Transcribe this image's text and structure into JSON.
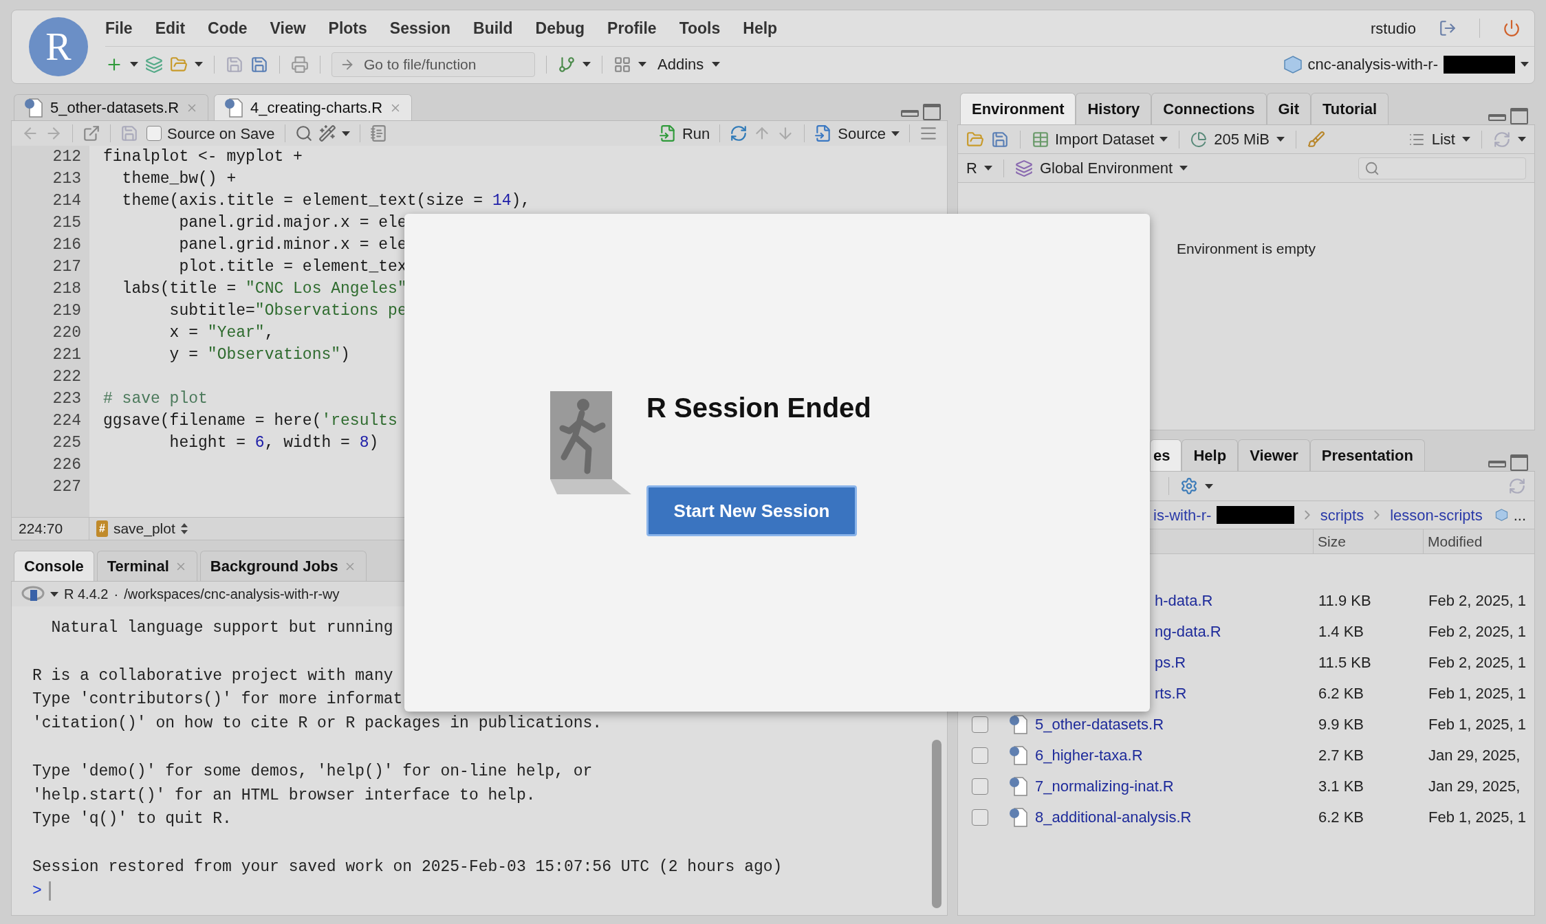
{
  "menu_bar": {
    "logo": "R",
    "items": [
      "File",
      "Edit",
      "Code",
      "View",
      "Plots",
      "Session",
      "Build",
      "Debug",
      "Profile",
      "Tools",
      "Help"
    ],
    "user": "rstudio"
  },
  "main_toolbar": {
    "goto_placeholder": "Go to file/function",
    "addins": "Addins",
    "project": "cnc-analysis-with-r-"
  },
  "editor": {
    "tabs": [
      {
        "label": "5_other-datasets.R",
        "selected": false
      },
      {
        "label": "4_creating-charts.R",
        "selected": true
      }
    ],
    "toolbar": {
      "source_on_save": {
        "label": "Source on Save",
        "checked": false
      },
      "run": "Run",
      "source": "Source"
    },
    "lines": [
      {
        "number": "212",
        "tokens": [
          {
            "kind": "code",
            "text": "finalplot <- myplot +"
          }
        ]
      },
      {
        "number": "213",
        "tokens": [
          {
            "kind": "code",
            "text": "  theme_bw() +"
          }
        ]
      },
      {
        "number": "214",
        "tokens": [
          {
            "kind": "code",
            "text": "  theme(axis.title = element_text(size = "
          },
          {
            "kind": "num",
            "text": "14"
          },
          {
            "kind": "code",
            "text": "),"
          }
        ]
      },
      {
        "number": "215",
        "tokens": [
          {
            "kind": "code",
            "text": "        panel.grid.major.x = ele"
          }
        ]
      },
      {
        "number": "216",
        "tokens": [
          {
            "kind": "code",
            "text": "        panel.grid.minor.x = ele"
          }
        ]
      },
      {
        "number": "217",
        "tokens": [
          {
            "kind": "code",
            "text": "        plot.title = element_tex"
          }
        ]
      },
      {
        "number": "218",
        "tokens": [
          {
            "kind": "code",
            "text": "  labs(title = "
          },
          {
            "kind": "str",
            "text": "\"CNC Los Angeles\""
          }
        ]
      },
      {
        "number": "219",
        "tokens": [
          {
            "kind": "code",
            "text": "       subtitle="
          },
          {
            "kind": "str",
            "text": "\"Observations pe"
          }
        ]
      },
      {
        "number": "220",
        "tokens": [
          {
            "kind": "code",
            "text": "       x = "
          },
          {
            "kind": "str",
            "text": "\"Year\""
          },
          {
            "kind": "code",
            "text": ","
          }
        ]
      },
      {
        "number": "221",
        "tokens": [
          {
            "kind": "code",
            "text": "       y = "
          },
          {
            "kind": "str",
            "text": "\"Observations\""
          },
          {
            "kind": "code",
            "text": ")"
          }
        ]
      },
      {
        "number": "222"
      },
      {
        "number": "223",
        "tokens": [
          {
            "kind": "cmt",
            "text": "# save plot"
          }
        ]
      },
      {
        "number": "224",
        "tokens": [
          {
            "kind": "code",
            "text": "ggsave(filename = here("
          },
          {
            "kind": "str",
            "text": "'results"
          }
        ]
      },
      {
        "number": "225",
        "tokens": [
          {
            "kind": "code",
            "text": "       height = "
          },
          {
            "kind": "num",
            "text": "6"
          },
          {
            "kind": "code",
            "text": ", width = "
          },
          {
            "kind": "num",
            "text": "8"
          },
          {
            "kind": "code",
            "text": ")"
          }
        ]
      },
      {
        "number": "226"
      },
      {
        "number": "227"
      }
    ],
    "status": {
      "position": "224:70",
      "section_badge": "#",
      "section": "save_plot"
    }
  },
  "console": {
    "tabs": [
      {
        "label": "Console",
        "selected": true,
        "closable": false
      },
      {
        "label": "Terminal",
        "selected": false,
        "closable": true
      },
      {
        "label": "Background Jobs",
        "selected": false,
        "closable": true
      }
    ],
    "version": "R 4.4.2",
    "separator": "·",
    "path": "/workspaces/cnc-analysis-with-r-wy",
    "paragraphs": [
      [
        "  Natural language support but running"
      ],
      [
        "R is a collaborative project with many",
        "Type 'contributors()' for more informat",
        "'citation()' on how to cite R or R packages in publications."
      ],
      [
        "Type 'demo()' for some demos, 'help()' for on-line help, or",
        "'help.start()' for an HTML browser interface to help.",
        "Type 'q()' to quit R."
      ],
      [
        "Session restored from your saved work on 2025-Feb-03 15:07:56 UTC (2 hours ago)"
      ]
    ],
    "prompt": ">"
  },
  "environment": {
    "tabs": [
      {
        "label": "Environment",
        "selected": true
      },
      {
        "label": "History",
        "selected": false
      },
      {
        "label": "Connections",
        "selected": false
      },
      {
        "label": "Git",
        "selected": false
      },
      {
        "label": "Tutorial",
        "selected": false
      }
    ],
    "toolbar": {
      "import": "Import Dataset",
      "memory": "205 MiB",
      "view": "List"
    },
    "language": "R",
    "scope": "Global Environment",
    "empty_message": "Environment is empty"
  },
  "files": {
    "tabs": [
      {
        "label": "es",
        "selected": true
      },
      {
        "label": "Help",
        "selected": false
      },
      {
        "label": "Viewer",
        "selected": false
      },
      {
        "label": "Presentation",
        "selected": false
      }
    ],
    "breadcrumb": {
      "start": "is-with-r-",
      "folders": [
        "scripts",
        "lesson-scripts"
      ],
      "more": "..."
    },
    "columns": [
      "Size",
      "Modified"
    ],
    "rows": [
      {
        "kind": "clipped",
        "name": "h-data.R",
        "size": "11.9 KB",
        "modified": "Feb 2, 2025, 1"
      },
      {
        "kind": "clipped",
        "name": "ng-data.R",
        "size": "1.4 KB",
        "modified": "Feb 2, 2025, 1"
      },
      {
        "kind": "clipped",
        "name": "ps.R",
        "size": "11.5 KB",
        "modified": "Feb 2, 2025, 1"
      },
      {
        "kind": "clipped",
        "name": "rts.R",
        "size": "6.2 KB",
        "modified": "Feb 1, 2025, 1"
      },
      {
        "kind": "full",
        "name": "5_other-datasets.R",
        "checked": false,
        "size": "9.9 KB",
        "modified": "Feb 1, 2025, 1"
      },
      {
        "kind": "full",
        "name": "6_higher-taxa.R",
        "checked": false,
        "size": "2.7 KB",
        "modified": "Jan 29, 2025,"
      },
      {
        "kind": "full",
        "name": "7_normalizing-inat.R",
        "checked": false,
        "size": "3.1 KB",
        "modified": "Jan 29, 2025,"
      },
      {
        "kind": "full",
        "name": "8_additional-analysis.R",
        "checked": false,
        "size": "6.2 KB",
        "modified": "Feb 1, 2025, 1"
      }
    ]
  },
  "dialog": {
    "title": "R Session Ended",
    "button": "Start New Session"
  }
}
